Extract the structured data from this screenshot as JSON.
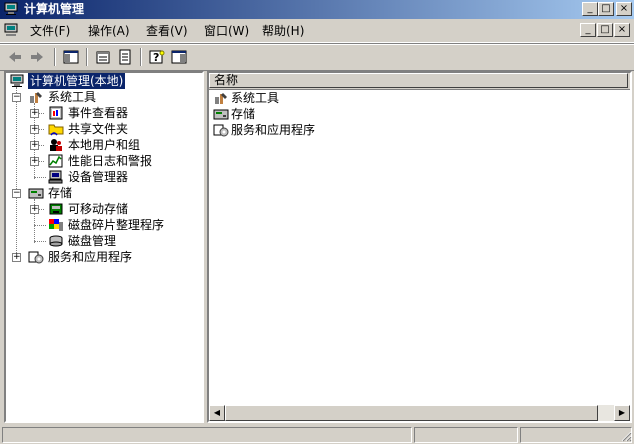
{
  "window": {
    "title": "计算机管理"
  },
  "caption_buttons": {
    "minimize": "_",
    "maximize": "□",
    "close": "×"
  },
  "menubar": {
    "items": [
      {
        "label": "文件(F)"
      },
      {
        "label": "操作(A)"
      },
      {
        "label": "查看(V)"
      },
      {
        "label": "窗口(W)"
      },
      {
        "label": "帮助(H)"
      }
    ]
  },
  "toolbar": {
    "icons": [
      "back-arrow-icon",
      "forward-arrow-icon",
      "show-hide-tree-icon",
      "properties-icon",
      "export-list-icon",
      "help-icon",
      "show-hide-action-pane-icon"
    ]
  },
  "tree": {
    "root": "计算机管理(本地)",
    "system_tools": "系统工具",
    "event_viewer": "事件查看器",
    "shared_folders": "共享文件夹",
    "local_users": "本地用户和组",
    "perf_logs": "性能日志和警报",
    "device_manager": "设备管理器",
    "storage": "存储",
    "removable_storage": "可移动存储",
    "defrag": "磁盘碎片整理程序",
    "disk_mgmt": "磁盘管理",
    "services_apps": "服务和应用程序"
  },
  "list": {
    "column_header": "名称",
    "items": [
      {
        "label": "系统工具"
      },
      {
        "label": "存储"
      },
      {
        "label": "服务和应用程序"
      }
    ]
  },
  "colors": {
    "title_start": "#0a246a",
    "title_end": "#a6caf0",
    "face": "#d4d0c8",
    "selection": "#0a246a"
  }
}
